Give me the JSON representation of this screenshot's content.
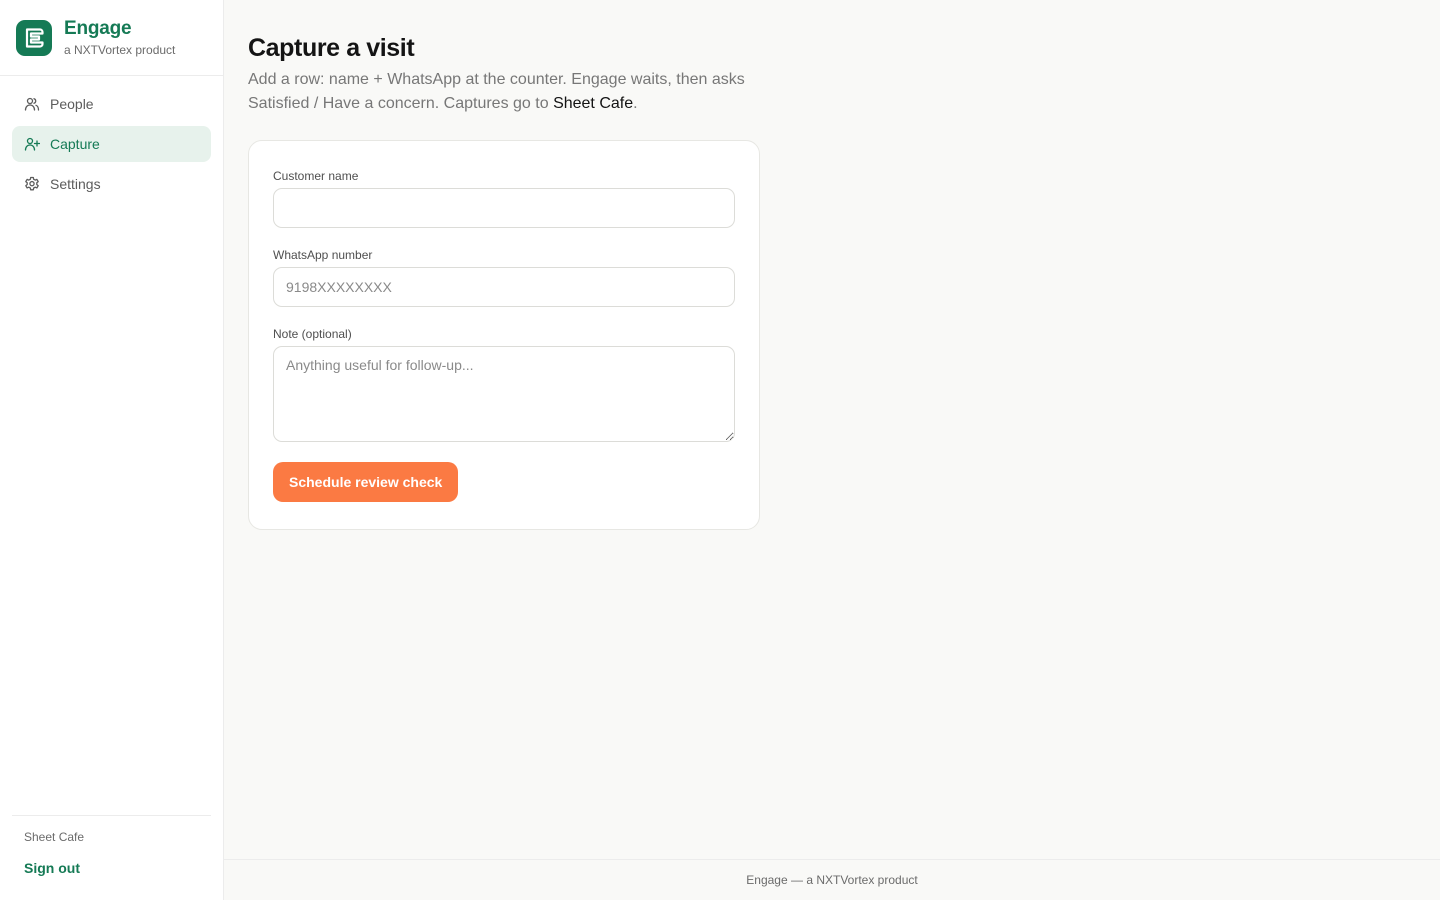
{
  "brand": {
    "name": "Engage",
    "subtitle": "a NXTVortex product",
    "accent": "#157a55"
  },
  "nav": {
    "items": [
      {
        "label": "People",
        "icon": "users-icon",
        "active": false
      },
      {
        "label": "Capture",
        "icon": "user-plus-icon",
        "active": true
      },
      {
        "label": "Settings",
        "icon": "gear-icon",
        "active": false
      }
    ]
  },
  "sidebar_footer": {
    "org_name": "Sheet Cafe",
    "sign_out": "Sign out"
  },
  "page": {
    "title": "Capture a visit",
    "description_prefix": "Add a row: name + WhatsApp at the counter. Engage waits, then asks Satisfied / Have a concern. Captures go to ",
    "description_highlight": "Sheet Cafe",
    "description_suffix": "."
  },
  "form": {
    "customer_name": {
      "label": "Customer name",
      "value": "",
      "placeholder": ""
    },
    "whatsapp": {
      "label": "WhatsApp number",
      "value": "",
      "placeholder": "9198XXXXXXXX"
    },
    "note": {
      "label": "Note (optional)",
      "value": "",
      "placeholder": "Anything useful for follow-up..."
    },
    "submit_label": "Schedule review check",
    "submit_color": "#fb7a43"
  },
  "footer": {
    "text": "Engage — a NXTVortex product"
  }
}
